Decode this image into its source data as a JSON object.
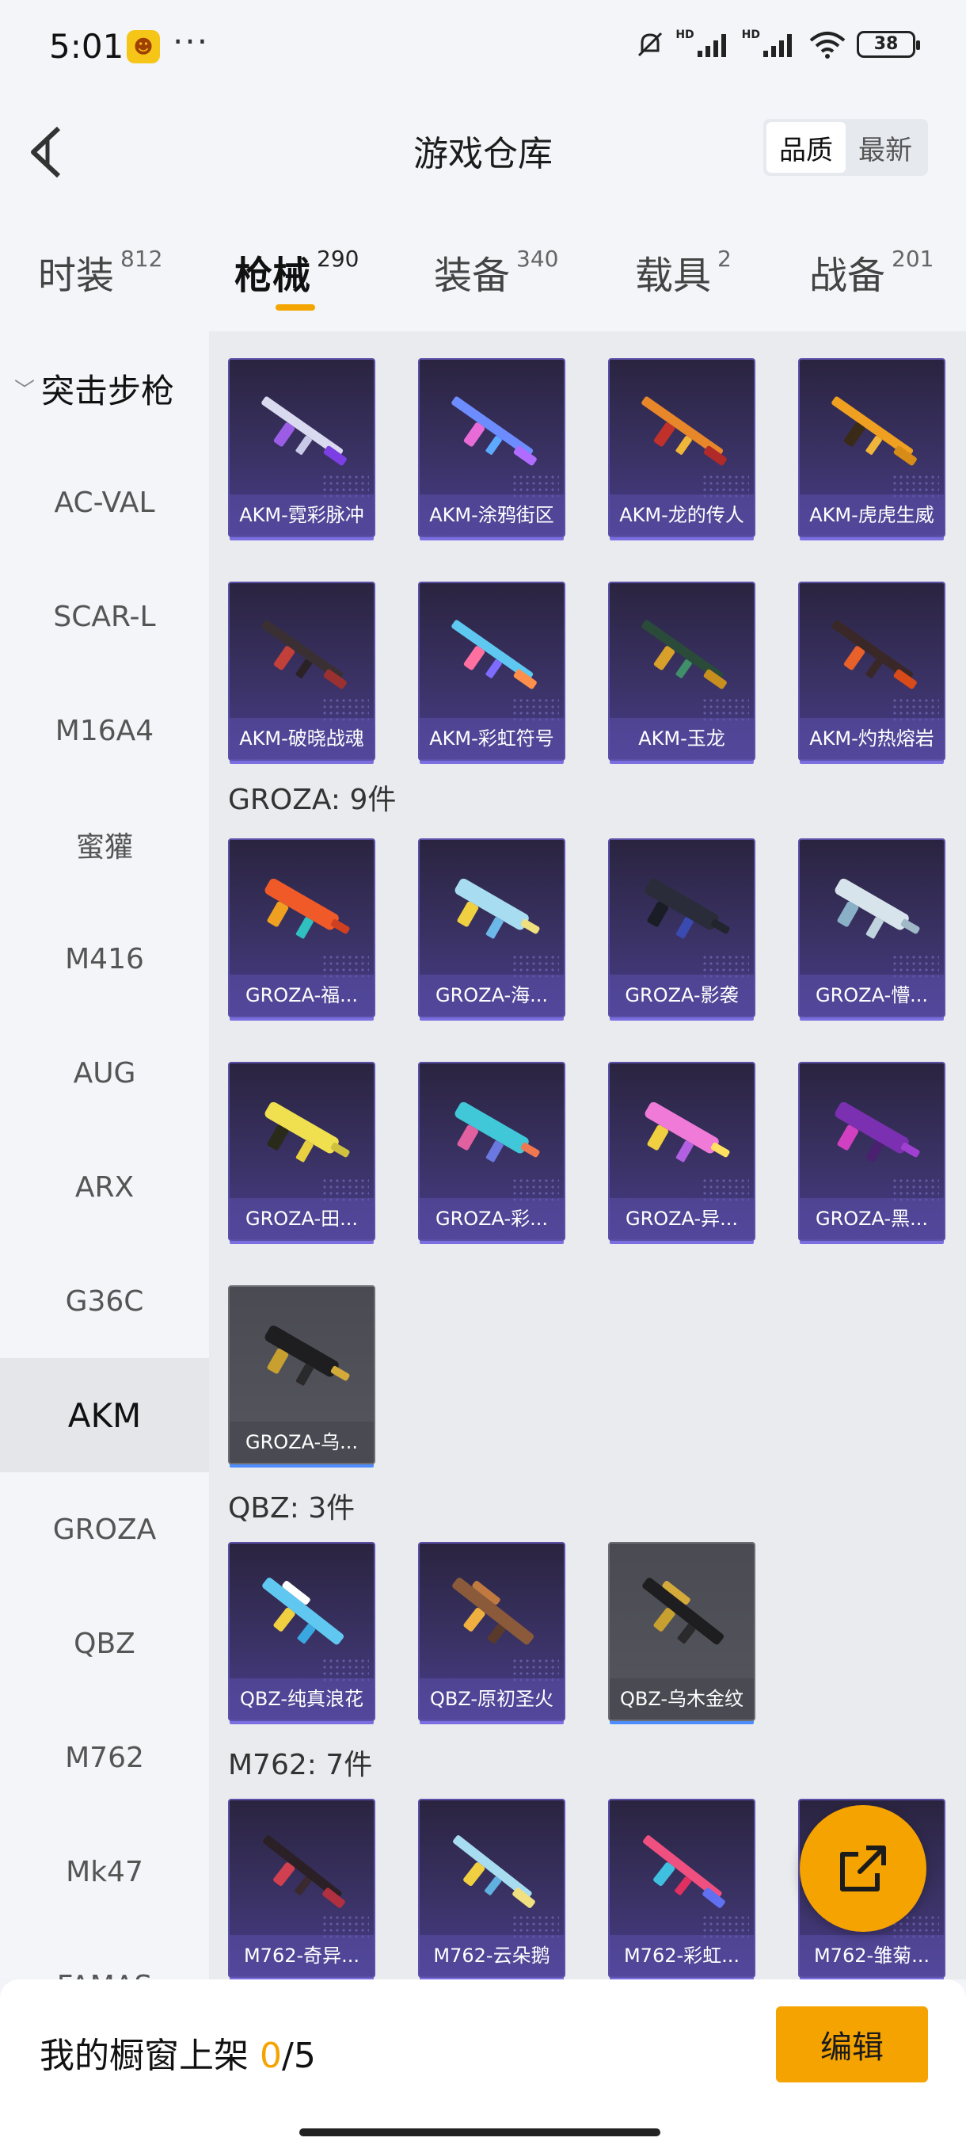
{
  "status_bar": {
    "time": "5:01",
    "battery": "38",
    "more": "···",
    "hd1": "HD",
    "hd2": "HD"
  },
  "header": {
    "title": "游戏仓库",
    "sort_options": [
      "品质",
      "最新"
    ]
  },
  "tabs": [
    {
      "label": "时装",
      "count": "812"
    },
    {
      "label": "枪械",
      "count": "290"
    },
    {
      "label": "装备",
      "count": "340"
    },
    {
      "label": "载具",
      "count": "2"
    },
    {
      "label": "战备",
      "count": "201"
    }
  ],
  "sidebar": {
    "category": "突击步枪",
    "items": [
      "AC-VAL",
      "SCAR-L",
      "M16A4",
      "蜜獾",
      "M416",
      "AUG",
      "ARX",
      "G36C",
      "AKM",
      "GROZA",
      "QBZ",
      "M762",
      "Mk47",
      "FAMAS"
    ]
  },
  "sections": {
    "akm": {
      "items": [
        "AKM-霓彩脉冲",
        "AKM-涂鸦街区",
        "AKM-龙的传人",
        "AKM-虎虎生威",
        "AKM-破晓战魂",
        "AKM-彩虹符号",
        "AKM-玉龙",
        "AKM-灼热熔岩"
      ]
    },
    "groza": {
      "title": "GROZA: 9件",
      "items": [
        "GROZA-福...",
        "GROZA-海...",
        "GROZA-影袭",
        "GROZA-懵...",
        "GROZA-田...",
        "GROZA-彩...",
        "GROZA-异...",
        "GROZA-黑...",
        "GROZA-乌..."
      ]
    },
    "qbz": {
      "title": "QBZ: 3件",
      "items": [
        "QBZ-纯真浪花",
        "QBZ-原初圣火",
        "QBZ-乌木金纹"
      ]
    },
    "m762": {
      "title": "M762: 7件",
      "items": [
        "M762-奇异...",
        "M762-云朵鹅",
        "M762-彩虹...",
        "M762-雏菊..."
      ]
    }
  },
  "bottom_bar": {
    "showcase_label": "我的橱窗上架",
    "showcase_count": "0",
    "showcase_total": "/5",
    "edit_label": "编辑"
  },
  "colors": {
    "accent": "#f5a300",
    "card_purple": "#3a3264",
    "card_gray": "#55565e"
  }
}
